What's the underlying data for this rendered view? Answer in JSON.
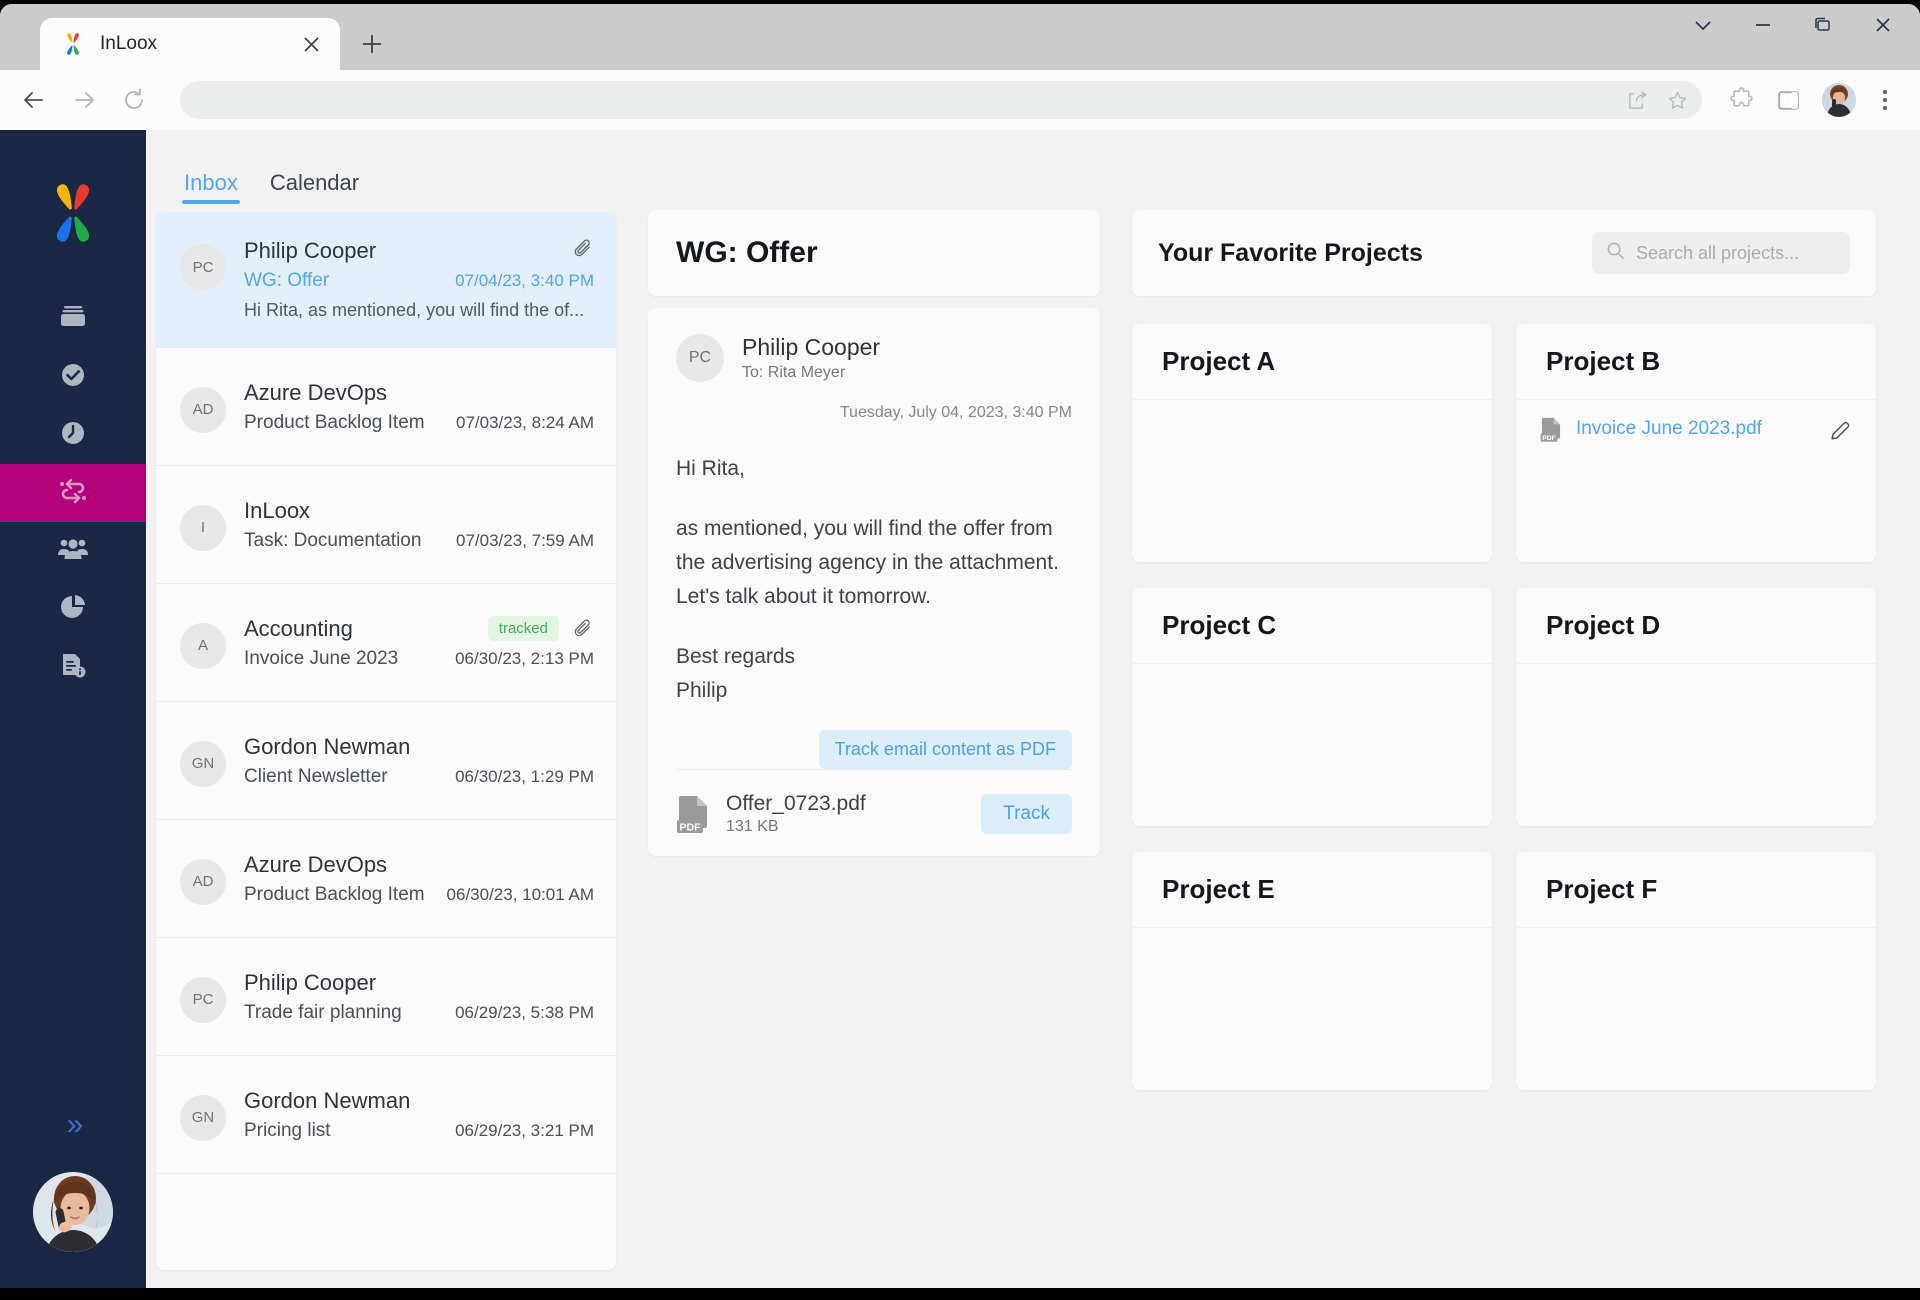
{
  "browser": {
    "tab": {
      "title": "InLoox",
      "favicon": "inloox-logo-icon",
      "close": "×"
    },
    "new_tab_label": "+",
    "window_controls": [
      "chevron-down-icon",
      "minimize-icon",
      "restore-icon",
      "close-icon"
    ],
    "nav": {
      "back": "back-icon",
      "forward": "forward-icon",
      "reload": "reload-icon"
    },
    "omnibox": {
      "value": "",
      "placeholder": ""
    },
    "omnibox_icons": [
      "share-icon",
      "bookmark-star-icon"
    ],
    "toolbar_icons": [
      "extensions-puzzle-icon",
      "sidepanel-icon",
      "profile-avatar",
      "kebab-menu-icon"
    ]
  },
  "rail": {
    "logo": "inloox-butterfly-logo",
    "items": [
      {
        "icon": "projects-icon",
        "name": "projects",
        "selected": false
      },
      {
        "icon": "tasks-check-icon",
        "name": "tasks",
        "selected": false
      },
      {
        "icon": "time-tracking-icon",
        "name": "time-tracking",
        "selected": false
      },
      {
        "icon": "mail-integration-icon",
        "name": "mail-integration",
        "selected": true
      },
      {
        "icon": "contacts-icon",
        "name": "contacts",
        "selected": false
      },
      {
        "icon": "reports-pie-icon",
        "name": "reports",
        "selected": false
      },
      {
        "icon": "documents-info-icon",
        "name": "documents",
        "selected": false
      }
    ],
    "expand_label": "»",
    "user_avatar": "user-avatar"
  },
  "inbox": {
    "tabs": [
      {
        "label": "Inbox",
        "active": true
      },
      {
        "label": "Calendar",
        "active": false
      }
    ],
    "messages": [
      {
        "initials": "PC",
        "from": "Philip Cooper",
        "subject": "WG: Offer",
        "date": "07/04/23, 3:40 PM",
        "preview": "Hi Rita, as mentioned, you will find the of...",
        "tracked": false,
        "attachment": true,
        "selected": true
      },
      {
        "initials": "AD",
        "from": "Azure DevOps",
        "subject": "Product Backlog Item",
        "date": "07/03/23, 8:24 AM",
        "preview": "",
        "tracked": false,
        "attachment": false,
        "selected": false
      },
      {
        "initials": "I",
        "from": "InLoox",
        "subject": "Task: Documentation",
        "date": "07/03/23, 7:59 AM",
        "preview": "",
        "tracked": false,
        "attachment": false,
        "selected": false
      },
      {
        "initials": "A",
        "from": "Accounting",
        "subject": "Invoice June 2023",
        "date": "06/30/23, 2:13 PM",
        "preview": "",
        "tracked": true,
        "tracked_label": "tracked",
        "attachment": true,
        "selected": false
      },
      {
        "initials": "GN",
        "from": "Gordon Newman",
        "subject": "Client Newsletter",
        "date": "06/30/23, 1:29 PM",
        "preview": "",
        "tracked": false,
        "attachment": false,
        "selected": false
      },
      {
        "initials": "AD",
        "from": "Azure DevOps",
        "subject": "Product Backlog Item",
        "date": "06/30/23, 10:01 AM",
        "preview": "",
        "tracked": false,
        "attachment": false,
        "selected": false
      },
      {
        "initials": "PC",
        "from": "Philip Cooper",
        "subject": "Trade fair planning",
        "date": "06/29/23, 5:38 PM",
        "preview": "",
        "tracked": false,
        "attachment": false,
        "selected": false
      },
      {
        "initials": "GN",
        "from": "Gordon Newman",
        "subject": "Pricing list",
        "date": "06/29/23, 3:21 PM",
        "preview": "",
        "tracked": false,
        "attachment": false,
        "selected": false
      }
    ]
  },
  "reader": {
    "title": "WG: Offer",
    "sender_initials": "PC",
    "sender_name": "Philip Cooper",
    "recipient": "To: Rita Meyer",
    "date": "Tuesday, July 04, 2023, 3:40 PM",
    "paragraphs": [
      "Hi Rita,",
      "as mentioned, you will find the offer from the advertising agency in the attachment.\nLet's talk about it tomorrow.",
      "Best regards\nPhilip"
    ],
    "track_pdf_label": "Track email content as PDF",
    "attachment": {
      "icon": "pdf-file-icon",
      "name": "Offer_0723.pdf",
      "size": "131 KB",
      "track_label": "Track"
    }
  },
  "projects": {
    "header_title": "Your Favorite Projects",
    "search_placeholder": "Search all projects...",
    "search_value": "",
    "cards": [
      {
        "title": "Project A",
        "files": []
      },
      {
        "title": "Project B",
        "files": [
          {
            "name": "Invoice June 2023.pdf",
            "icon": "pdf-file-icon",
            "edit_icon": "pencil-icon"
          }
        ]
      },
      {
        "title": "Project C",
        "files": []
      },
      {
        "title": "Project D",
        "files": []
      },
      {
        "title": "Project E",
        "files": []
      },
      {
        "title": "Project F",
        "files": []
      }
    ]
  },
  "colors": {
    "rail_bg": "#1b2845",
    "rail_selected": "#b3007b",
    "accent_blue": "#54a5ef",
    "tracked_green": "#4aa85c",
    "page_bg": "#f2f2f2",
    "card_bg": "#fafafa"
  }
}
